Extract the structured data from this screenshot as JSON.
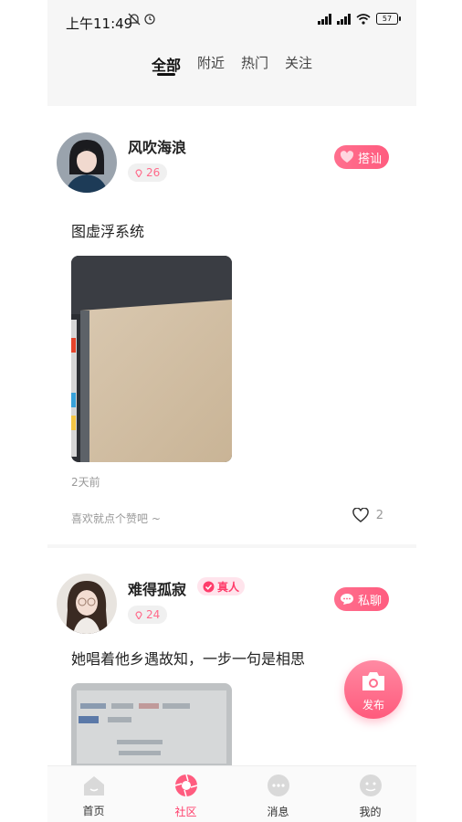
{
  "status_bar": {
    "time": "上午11:49",
    "battery": "57"
  },
  "tabs": [
    {
      "label": "全部"
    },
    {
      "label": "附近"
    },
    {
      "label": "热门"
    },
    {
      "label": "关注"
    }
  ],
  "posts": [
    {
      "username": "风吹海浪",
      "distance": "26",
      "action": "搭讪",
      "content": "图虚浮系统",
      "time_ago": "2天前",
      "like_hint": "喜欢就点个赞吧 ~",
      "likes": "2"
    },
    {
      "username": "难得孤寂",
      "verified": "真人",
      "distance": "24",
      "action": "私聊",
      "content": "她唱着他乡遇故知，一步一句是相思"
    }
  ],
  "fab": {
    "label": "发布"
  },
  "bottom_nav": [
    {
      "label": "首页",
      "icon": "home-icon"
    },
    {
      "label": "社区",
      "icon": "community-icon"
    },
    {
      "label": "消息",
      "icon": "message-icon"
    },
    {
      "label": "我的",
      "icon": "profile-icon"
    }
  ],
  "colors": {
    "accent": "#ff5c7f",
    "distance": "#ff6a8a"
  }
}
